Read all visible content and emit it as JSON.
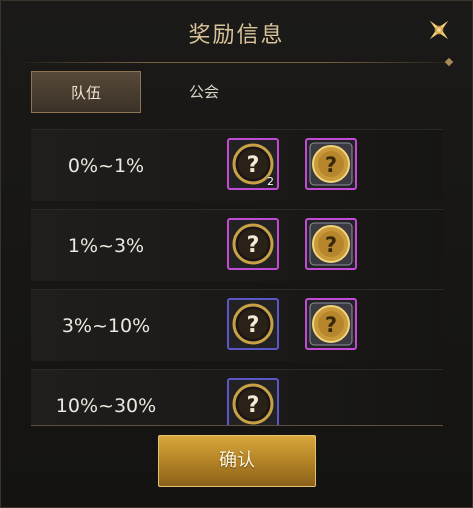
{
  "dialog": {
    "title": "奖励信息",
    "close_icon": "close-star-icon",
    "tabs": [
      {
        "label": "队伍",
        "active": true
      },
      {
        "label": "公会",
        "active": false
      }
    ],
    "rows": [
      {
        "range": "0%~1%",
        "rewards": [
          {
            "icon": "mystery-chest-icon",
            "rarity": "purple",
            "count": "2"
          },
          {
            "icon": "mystery-coin-icon",
            "rarity": "purple",
            "count": ""
          }
        ]
      },
      {
        "range": "1%~3%",
        "rewards": [
          {
            "icon": "mystery-chest-icon",
            "rarity": "purple",
            "count": ""
          },
          {
            "icon": "mystery-coin-icon",
            "rarity": "purple",
            "count": ""
          }
        ]
      },
      {
        "range": "3%~10%",
        "rewards": [
          {
            "icon": "mystery-chest-icon",
            "rarity": "blue",
            "count": ""
          },
          {
            "icon": "mystery-coin-icon",
            "rarity": "purple",
            "count": ""
          }
        ]
      },
      {
        "range": "10%~30%",
        "rewards": [
          {
            "icon": "mystery-chest-icon",
            "rarity": "blue",
            "count": ""
          }
        ]
      }
    ],
    "confirm_label": "确认"
  },
  "colors": {
    "title": "#d9c49a",
    "rarity_purple": "#c24bd6",
    "rarity_blue": "#5a57c9",
    "button_gold": "#b48326"
  }
}
